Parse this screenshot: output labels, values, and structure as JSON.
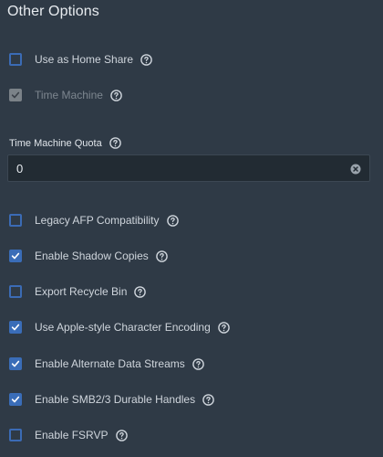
{
  "section": {
    "title": "Other Options"
  },
  "options": [
    {
      "label": "Use as Home Share",
      "checked": false,
      "disabled": false
    },
    {
      "label": "Time Machine",
      "checked": true,
      "disabled": true
    },
    {
      "label": "Legacy AFP Compatibility",
      "checked": false,
      "disabled": false
    },
    {
      "label": "Enable Shadow Copies",
      "checked": true,
      "disabled": false
    },
    {
      "label": "Export Recycle Bin",
      "checked": false,
      "disabled": false
    },
    {
      "label": "Use Apple-style Character Encoding",
      "checked": true,
      "disabled": false
    },
    {
      "label": "Enable Alternate Data Streams",
      "checked": true,
      "disabled": false
    },
    {
      "label": "Enable SMB2/3 Durable Handles",
      "checked": true,
      "disabled": false
    },
    {
      "label": "Enable FSRVP",
      "checked": false,
      "disabled": false
    }
  ],
  "quota": {
    "label": "Time Machine Quota",
    "value": "0"
  },
  "icons": {
    "help": "help-circle-icon",
    "clear": "clear-circle-icon",
    "check": "checkmark-icon"
  },
  "colors": {
    "background": "#2f3a46",
    "accent": "#3a6db8",
    "disabled": "#7b8288",
    "field": "#222b33"
  }
}
